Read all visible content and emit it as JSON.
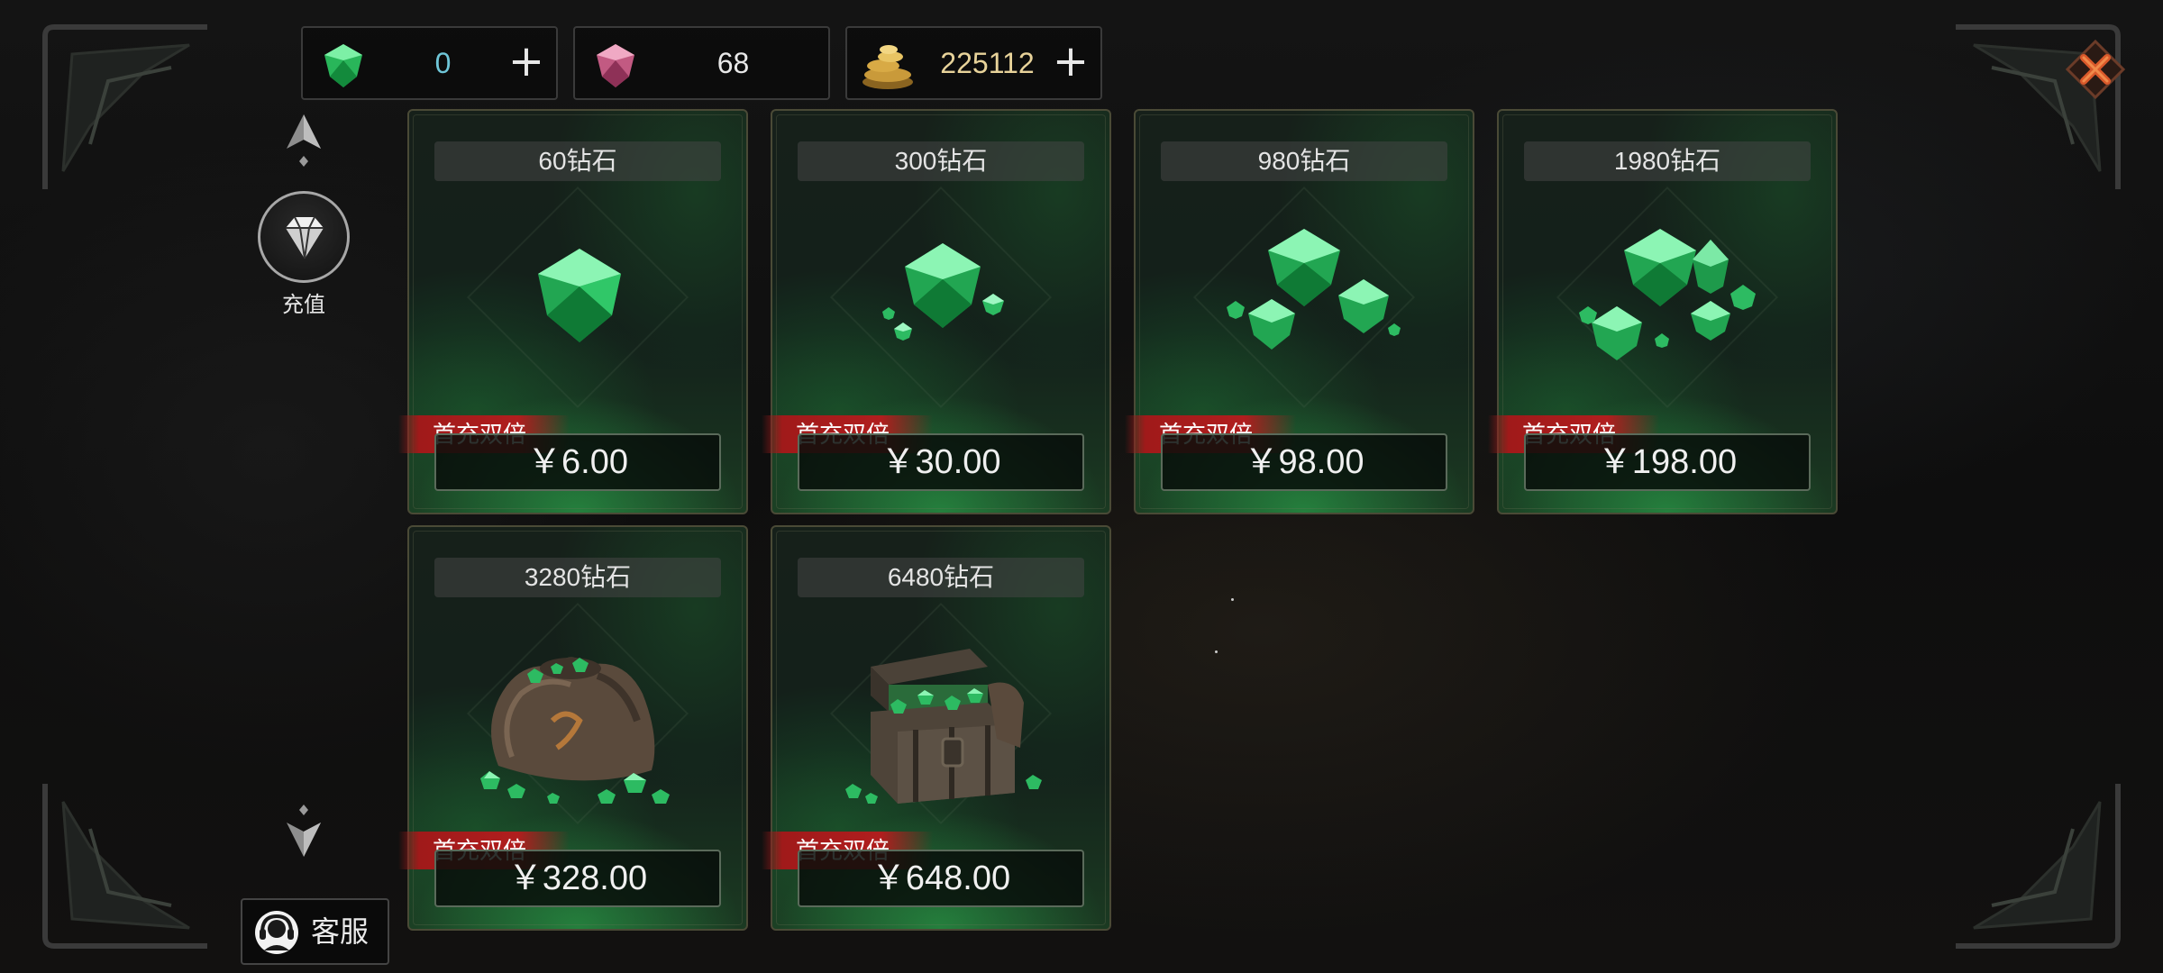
{
  "currencies": [
    {
      "icon": "green-diamond-icon",
      "value": "0",
      "value_color": "#6fc6d8",
      "has_plus": true,
      "plus": "+"
    },
    {
      "icon": "pink-diamond-icon",
      "value": "68",
      "value_color": "#e8e8e8",
      "has_plus": false
    },
    {
      "icon": "gold-coins-icon",
      "value": "225112",
      "value_color": "#e8d39a",
      "has_plus": true,
      "plus": "+"
    }
  ],
  "nav": {
    "active_tab_label": "充值",
    "customer_service_label": "客服"
  },
  "promo_label": "首充双倍",
  "products": [
    {
      "title": "60钻石",
      "price": "￥6.00",
      "art": "single-gem"
    },
    {
      "title": "300钻石",
      "price": "￥30.00",
      "art": "gem-small-cluster"
    },
    {
      "title": "980钻石",
      "price": "￥98.00",
      "art": "gem-cluster"
    },
    {
      "title": "1980钻石",
      "price": "￥198.00",
      "art": "gem-large-cluster"
    },
    {
      "title": "3280钻石",
      "price": "￥328.00",
      "art": "gem-sack"
    },
    {
      "title": "6480钻石",
      "price": "￥648.00",
      "art": "treasure-chest"
    }
  ],
  "colors": {
    "accent_green": "#2fbf62",
    "promo_red": "#b01e1e",
    "gold": "#e8d39a"
  }
}
